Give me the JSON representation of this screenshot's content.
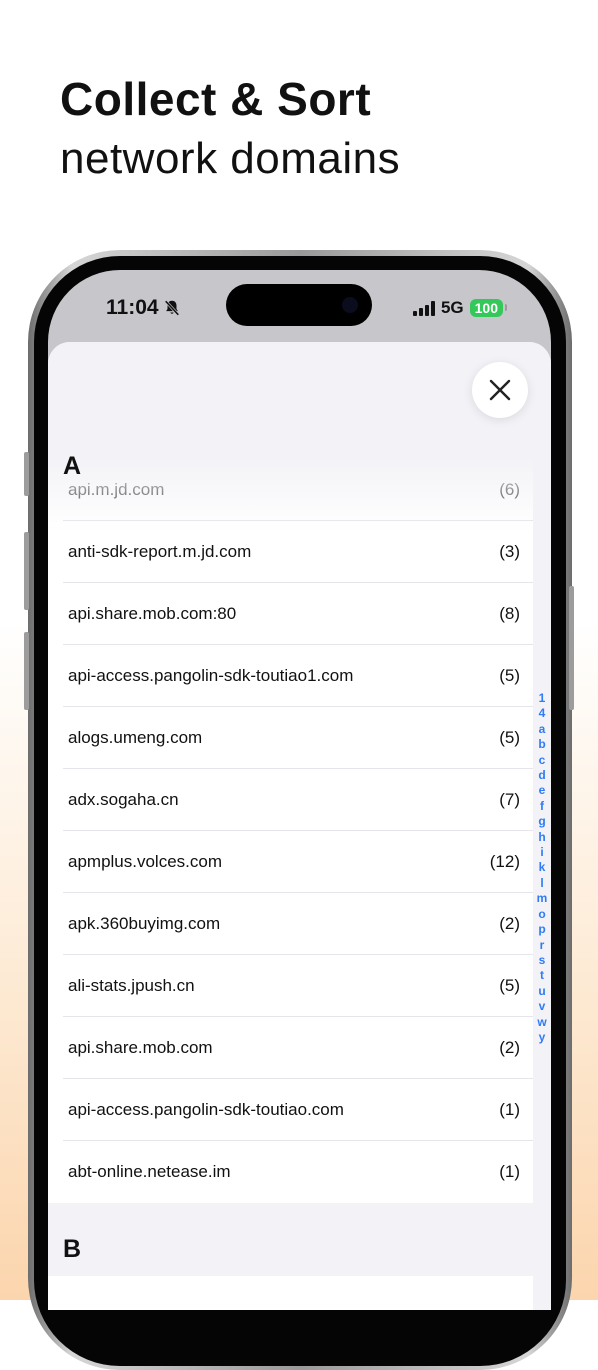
{
  "hero": {
    "title": "Collect & Sort",
    "subtitle": "network domains"
  },
  "status_bar": {
    "time": "11:04",
    "network": "5G",
    "battery": "100"
  },
  "sections": [
    {
      "letter": "A",
      "rows": [
        {
          "domain": "api.m.jd.com",
          "count": "(6)"
        },
        {
          "domain": "anti-sdk-report.m.jd.com",
          "count": "(3)"
        },
        {
          "domain": "api.share.mob.com:80",
          "count": "(8)"
        },
        {
          "domain": "api-access.pangolin-sdk-toutiao1.com",
          "count": "(5)"
        },
        {
          "domain": "alogs.umeng.com",
          "count": "(5)"
        },
        {
          "domain": "adx.sogaha.cn",
          "count": "(7)"
        },
        {
          "domain": "apmplus.volces.com",
          "count": "(12)"
        },
        {
          "domain": "apk.360buyimg.com",
          "count": "(2)"
        },
        {
          "domain": "ali-stats.jpush.cn",
          "count": "(5)"
        },
        {
          "domain": "api.share.mob.com",
          "count": "(2)"
        },
        {
          "domain": "api-access.pangolin-sdk-toutiao.com",
          "count": "(1)"
        },
        {
          "domain": "abt-online.netease.im",
          "count": "(1)"
        }
      ]
    },
    {
      "letter": "B",
      "rows": []
    }
  ],
  "index_letters": [
    "1",
    "4",
    "a",
    "b",
    "c",
    "d",
    "e",
    "f",
    "g",
    "h",
    "i",
    "k",
    "l",
    "m",
    "o",
    "p",
    "r",
    "s",
    "t",
    "u",
    "v",
    "w",
    "y"
  ],
  "icons": {
    "close": "close-icon",
    "mute": "bell-slash-icon"
  }
}
